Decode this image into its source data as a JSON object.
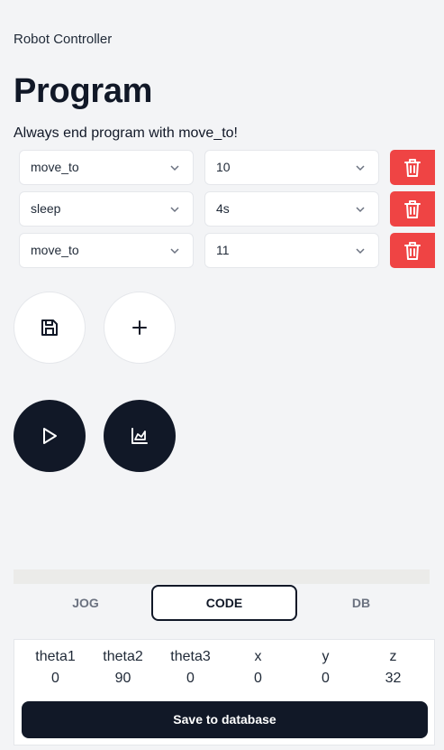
{
  "app": {
    "title": "Robot Controller"
  },
  "page": {
    "title": "Program",
    "hint": "Always end program with move_to!"
  },
  "program": {
    "rows": [
      {
        "command": "move_to",
        "argument": "10"
      },
      {
        "command": "sleep",
        "argument": "4s"
      },
      {
        "command": "move_to",
        "argument": "11"
      }
    ]
  },
  "icons": {
    "chevron": "chevron-down-icon",
    "delete": "trash-icon",
    "save": "floppy-disk-icon",
    "add": "plus-icon",
    "run": "play-icon",
    "chart": "chart-icon"
  },
  "tabs": [
    {
      "label": "JOG"
    },
    {
      "label": "CODE"
    },
    {
      "label": "DB"
    }
  ],
  "coords": {
    "headers": [
      "theta1",
      "theta2",
      "theta3",
      "x",
      "y",
      "z"
    ],
    "values": [
      "0",
      "90",
      "0",
      "0",
      "0",
      "32"
    ]
  },
  "panel": {
    "save_label": "Save to database"
  },
  "colors": {
    "accent": "#111827",
    "danger": "#ef4444",
    "background": "#f3f4f6"
  }
}
